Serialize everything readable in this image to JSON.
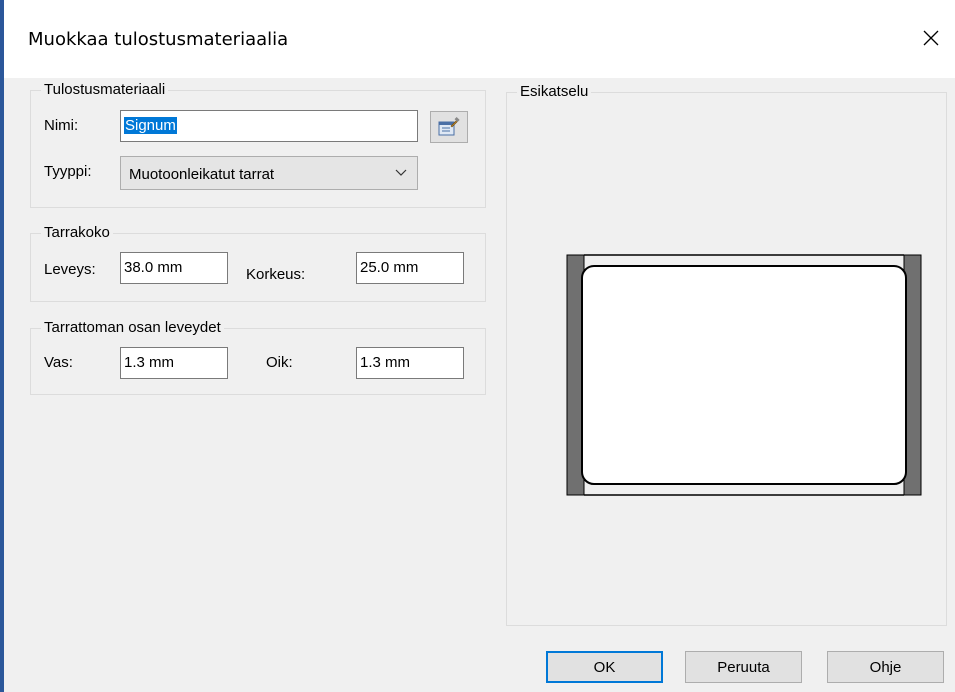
{
  "dialog": {
    "title": "Muokkaa tulostusmateriaalia"
  },
  "media": {
    "legend": "Tulostusmateriaali",
    "name_label": "Nimi:",
    "name_value": "Signum",
    "type_label": "Tyyppi:",
    "type_value": "Muotoonleikatut tarrat"
  },
  "label_size": {
    "legend": "Tarrakoko",
    "width_label": "Leveys:",
    "width_value": "38.0 mm",
    "height_label": "Korkeus:",
    "height_value": "25.0 mm"
  },
  "liner": {
    "legend": "Tarrattoman osan leveydet",
    "left_label": "Vas:",
    "left_value": "1.3 mm",
    "right_label": "Oik:",
    "right_value": "1.3 mm"
  },
  "preview": {
    "legend": "Esikatselu"
  },
  "buttons": {
    "ok": "OK",
    "cancel": "Peruuta",
    "help": "Ohje"
  },
  "colors": {
    "accent": "#0078d7",
    "liner": "#707070"
  },
  "icons": {
    "close": "close-icon",
    "properties": "properties-icon",
    "dropdown": "chevron-down-icon"
  }
}
